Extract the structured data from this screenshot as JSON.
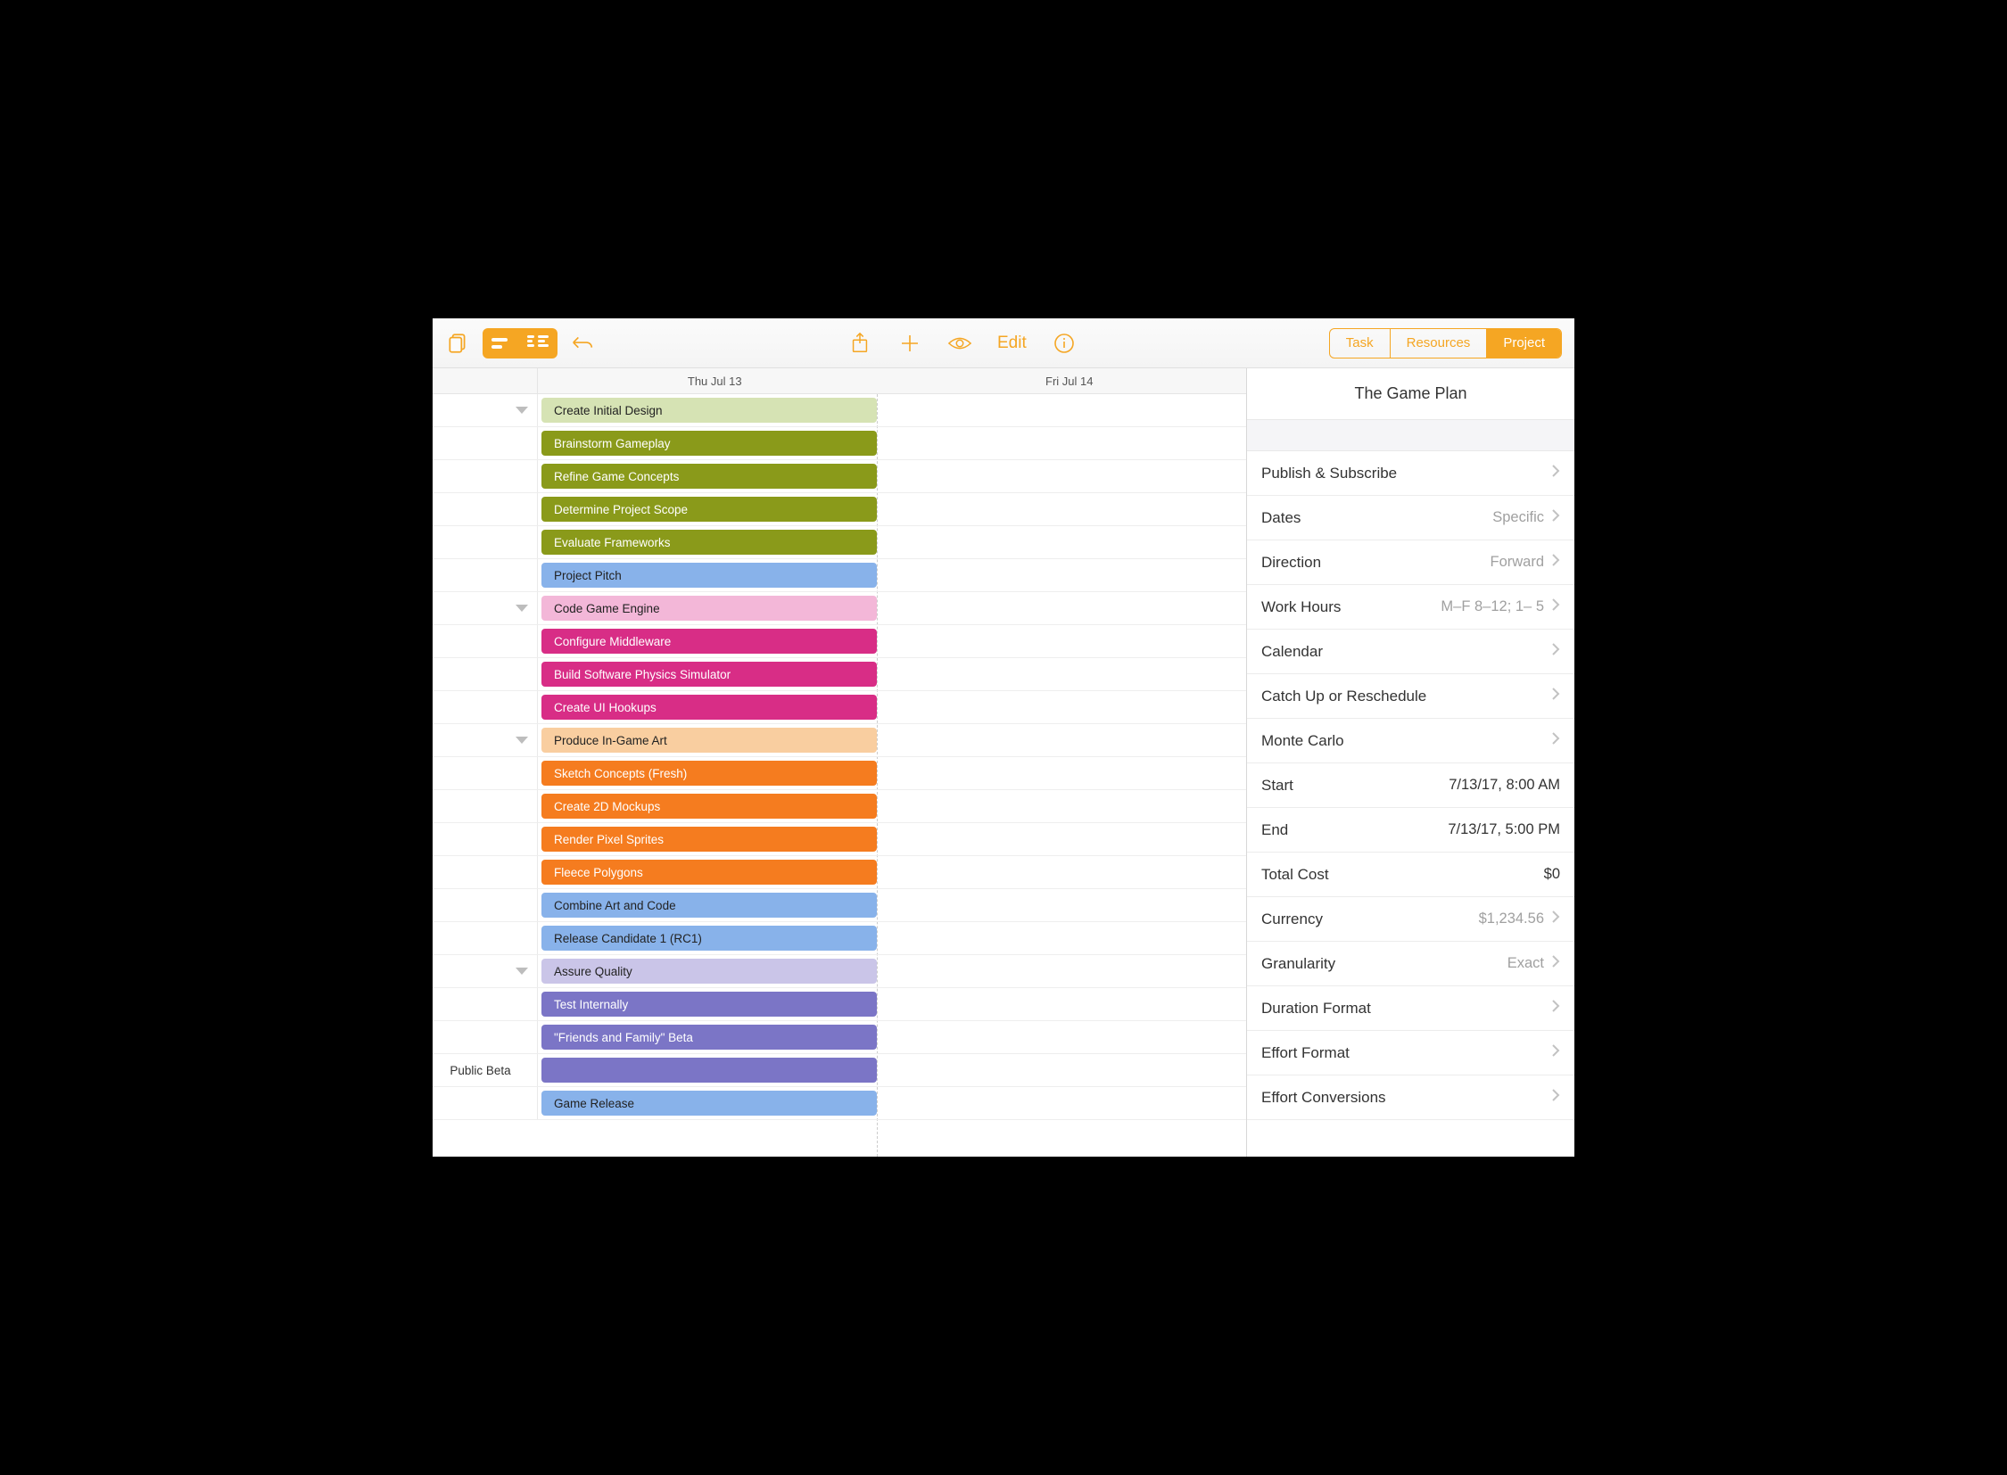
{
  "toolbar": {
    "edit_label": "Edit",
    "segments": [
      "Task",
      "Resources",
      "Project"
    ],
    "active_segment": 2
  },
  "gantt": {
    "days": [
      "Thu Jul 13",
      "Fri Jul 14"
    ],
    "rows": [
      {
        "disclosure": true,
        "label": "Create Initial Design",
        "color": "c-lt-green"
      },
      {
        "label": "Brainstorm Gameplay",
        "color": "c-olive"
      },
      {
        "label": "Refine Game Concepts",
        "color": "c-olive"
      },
      {
        "label": "Determine Project Scope",
        "color": "c-olive"
      },
      {
        "label": "Evaluate Frameworks",
        "color": "c-olive"
      },
      {
        "label": "Project Pitch",
        "color": "c-blue"
      },
      {
        "disclosure": true,
        "label": "Code Game Engine",
        "color": "c-pink"
      },
      {
        "label": "Configure Middleware",
        "color": "c-magenta"
      },
      {
        "label": "Build Software Physics Simulator",
        "color": "c-magenta"
      },
      {
        "label": "Create UI Hookups",
        "color": "c-magenta"
      },
      {
        "disclosure": true,
        "label": "Produce In-Game Art",
        "color": "c-peach"
      },
      {
        "label": "Sketch Concepts (Fresh)",
        "color": "c-orange"
      },
      {
        "label": "Create 2D Mockups",
        "color": "c-orange"
      },
      {
        "label": "Render Pixel Sprites",
        "color": "c-orange"
      },
      {
        "label": "Fleece Polygons",
        "color": "c-orange"
      },
      {
        "label": "Combine Art and Code",
        "color": "c-blue"
      },
      {
        "label": "Release Candidate 1 (RC1)",
        "color": "c-blue"
      },
      {
        "disclosure": true,
        "label": "Assure Quality",
        "color": "c-lav"
      },
      {
        "label": "Test Internally",
        "color": "c-purple"
      },
      {
        "label": "\"Friends and Family\" Beta",
        "color": "c-purple"
      },
      {
        "left_label": "Public Beta",
        "label": "",
        "color": "c-purple"
      },
      {
        "label": "Game Release",
        "color": "c-blue"
      }
    ]
  },
  "inspector": {
    "title": "The Game Plan",
    "items": [
      {
        "label": "Publish & Subscribe",
        "value": "",
        "chev": true
      },
      {
        "label": "Dates",
        "value": "Specific",
        "chev": true
      },
      {
        "label": "Direction",
        "value": "Forward",
        "chev": true
      },
      {
        "label": "Work Hours",
        "value": "M–F  8–12; 1– 5",
        "chev": true
      },
      {
        "label": "Calendar",
        "value": "",
        "chev": true
      },
      {
        "label": "Catch Up or Reschedule",
        "value": "",
        "chev": true
      },
      {
        "label": "Monte Carlo",
        "value": "",
        "chev": true
      },
      {
        "label": "Start",
        "value": "7/13/17, 8:00 AM",
        "dark": true,
        "chev": false
      },
      {
        "label": "End",
        "value": "7/13/17, 5:00 PM",
        "dark": true,
        "chev": false
      },
      {
        "label": "Total Cost",
        "value": "$0",
        "dark": true,
        "chev": false
      },
      {
        "label": "Currency",
        "value": "$1,234.56",
        "chev": true
      },
      {
        "label": "Granularity",
        "value": "Exact",
        "chev": true
      },
      {
        "label": "Duration Format",
        "value": "",
        "chev": true
      },
      {
        "label": "Effort Format",
        "value": "",
        "chev": true
      },
      {
        "label": "Effort Conversions",
        "value": "",
        "chev": true
      }
    ]
  }
}
